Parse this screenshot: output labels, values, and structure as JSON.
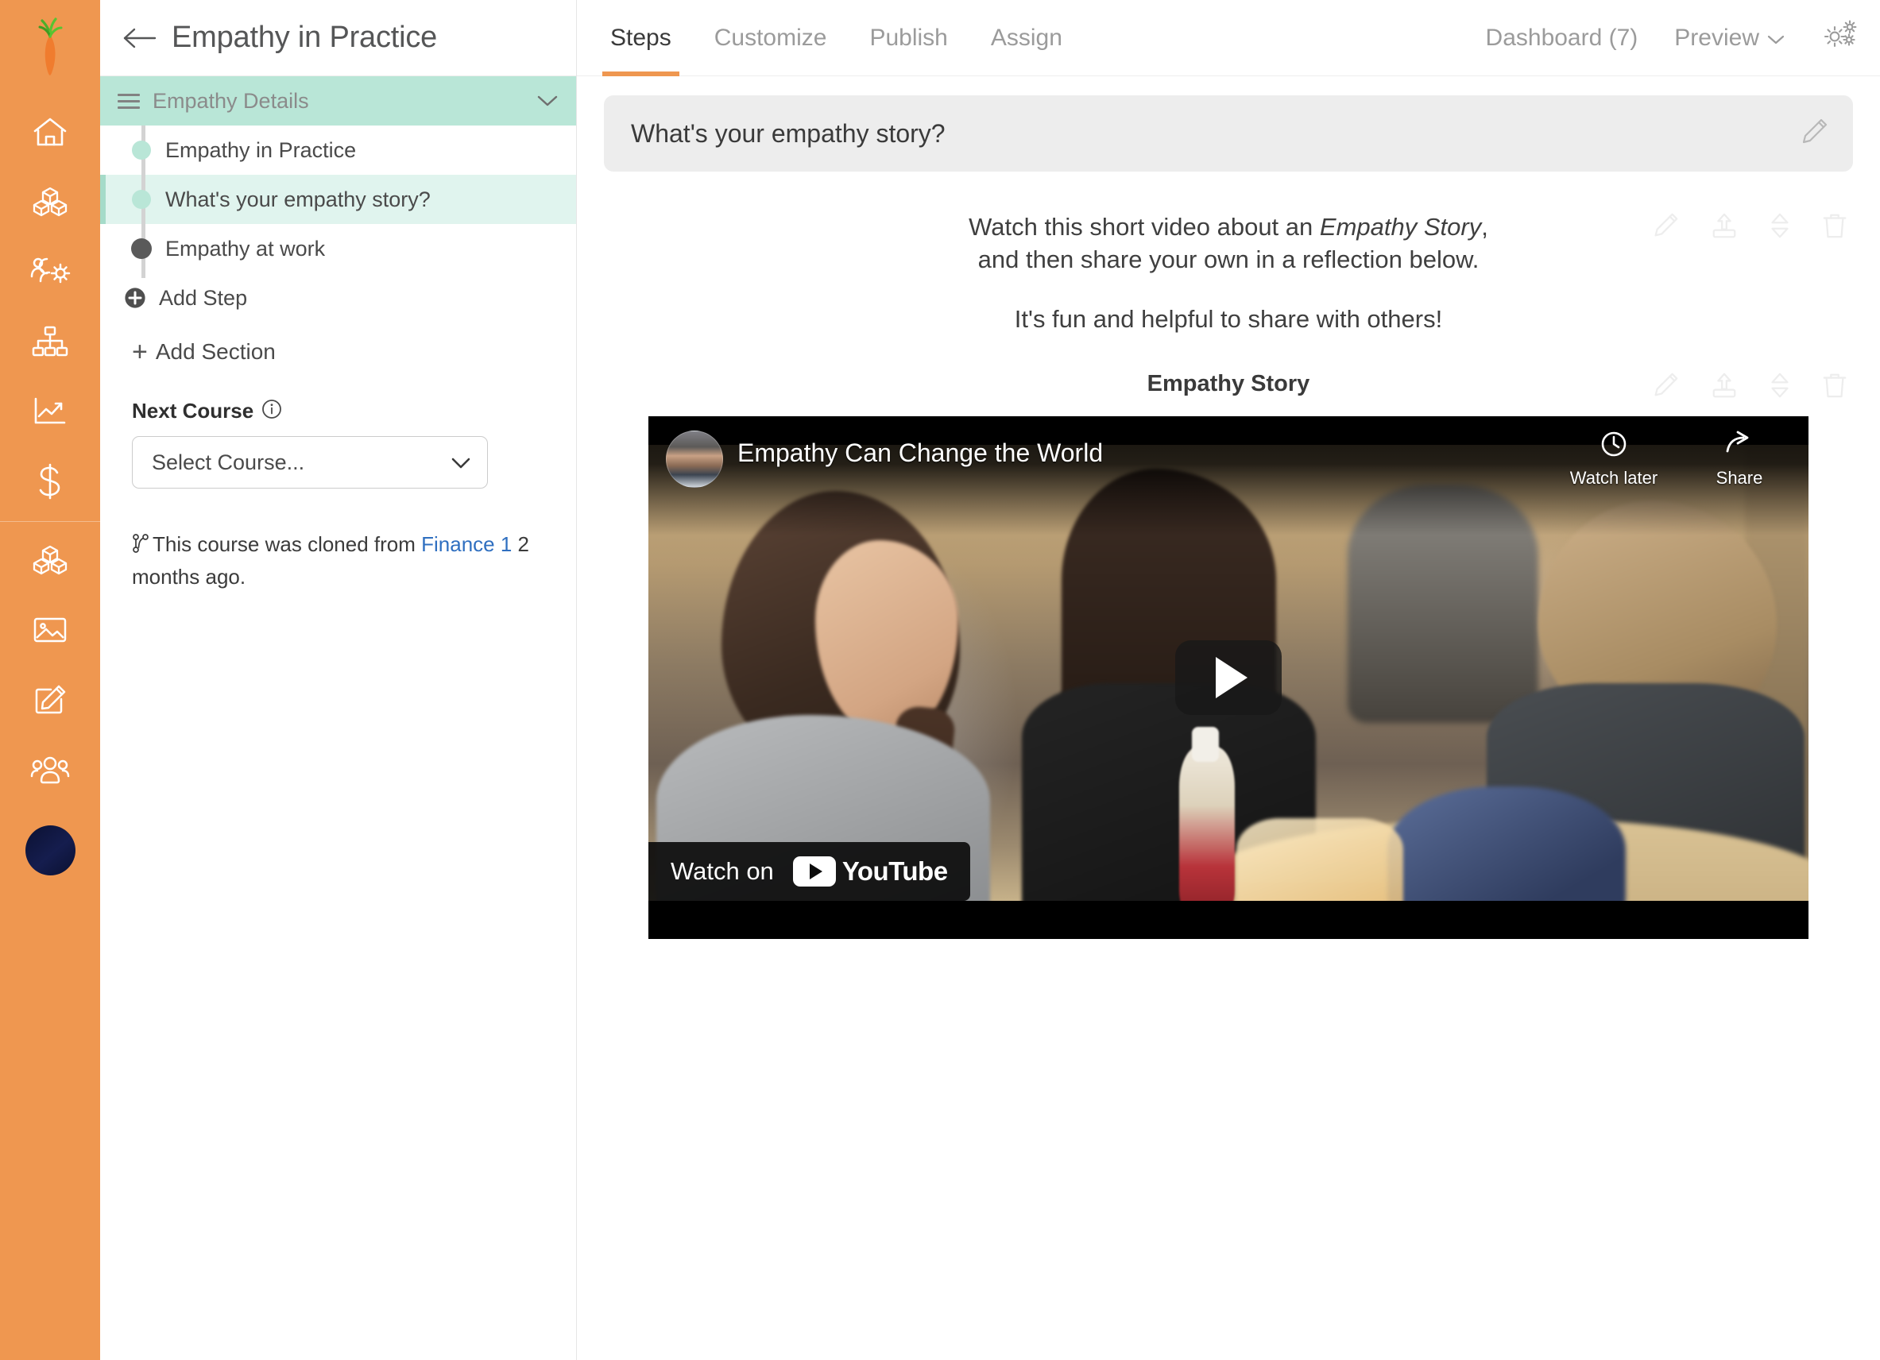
{
  "rail": {
    "logo_icon": "carrot-logo-icon",
    "items": [
      {
        "icon": "home-icon",
        "name": "home"
      },
      {
        "icon": "blocks-icon",
        "name": "library"
      },
      {
        "icon": "people-gear-icon",
        "name": "people-settings"
      },
      {
        "icon": "org-chart-icon",
        "name": "org-chart"
      },
      {
        "icon": "trend-chart-icon",
        "name": "analytics"
      },
      {
        "icon": "dollar-icon",
        "name": "billing"
      }
    ],
    "items2": [
      {
        "icon": "blocks-icon",
        "name": "courses"
      },
      {
        "icon": "image-icon",
        "name": "media"
      },
      {
        "icon": "edit-square-icon",
        "name": "authoring"
      },
      {
        "icon": "group-icon",
        "name": "teams"
      }
    ],
    "avatar": {
      "icon": "avatar",
      "name": "user-avatar"
    }
  },
  "outline": {
    "back_icon": "back-arrow-icon",
    "course_title": "Empathy in Practice",
    "section": {
      "drag_icon": "drag-handle-icon",
      "label": "Empathy Details",
      "collapse_icon": "chevron-down-icon"
    },
    "steps": [
      {
        "label": "Empathy in Practice",
        "selected": false
      },
      {
        "label": "What's your empathy story?",
        "selected": true
      },
      {
        "label": "Empathy at work",
        "selected": false
      }
    ],
    "add_step": {
      "label": "Add Step",
      "icon": "circle-plus-icon"
    },
    "add_section": {
      "label": "Add Section",
      "icon": "plus-icon"
    },
    "next_course": {
      "label": "Next Course",
      "info_icon": "info-icon",
      "select_value": "Select Course...",
      "caret_icon": "chevron-down-icon"
    },
    "clone_note": {
      "icon": "branch-icon",
      "prefix": "This course was cloned from ",
      "link": "Finance 1",
      "suffix": " 2 months ago."
    }
  },
  "topbar": {
    "tabs": [
      {
        "label": "Steps",
        "active": true
      },
      {
        "label": "Customize",
        "active": false
      },
      {
        "label": "Publish",
        "active": false
      },
      {
        "label": "Assign",
        "active": false
      }
    ],
    "dashboard_label": "Dashboard (7)",
    "preview_label": "Preview",
    "preview_caret_icon": "chevron-down-icon",
    "settings_icon": "gears-icon"
  },
  "content": {
    "question": "What's your empathy story?",
    "question_edit_icon": "pencil-icon",
    "text_block": {
      "actions": [
        "pencil-icon",
        "upload-icon",
        "reorder-icon",
        "trash-icon"
      ],
      "line1_a": "Watch this short video about an ",
      "line1_em": "Empathy Story",
      "line1_b": ",",
      "line2": "and then share your own in a reflection below.",
      "line3": "It's fun and helpful to share with others!"
    },
    "video_block": {
      "actions": [
        "pencil-icon",
        "upload-icon",
        "reorder-icon",
        "trash-icon"
      ],
      "caption": "Empathy Story",
      "player": {
        "title": "Empathy Can Change the World",
        "watch_later_label": "Watch later",
        "watch_later_icon": "clock-icon",
        "share_label": "Share",
        "share_icon": "share-arrow-icon",
        "play_icon": "play-icon",
        "watch_on_label": "Watch on",
        "brand": "YouTube",
        "channel_avatar": "channel-avatar"
      }
    }
  },
  "colors": {
    "rail_orange": "#ef9750",
    "section_teal": "#b9e6d7",
    "selected_teal": "#e0f4ee",
    "accent_underline": "#ef9750",
    "link_blue": "#2f6fc0"
  }
}
